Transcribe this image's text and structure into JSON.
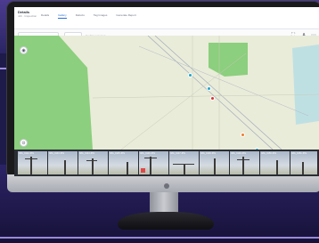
{
  "app": {
    "title": "Details",
    "subtitle": "Job · Inspection"
  },
  "tabs": [
    {
      "label": "Details",
      "active": false
    },
    {
      "label": "Gallery",
      "active": true
    },
    {
      "label": "Defects",
      "active": false
    },
    {
      "label": "Tag Images",
      "active": false
    },
    {
      "label": "Generate Report",
      "active": false
    }
  ],
  "toolbar": {
    "search_placeholder": "Search image",
    "filter_label": "Filter",
    "hint": "No filter selected"
  },
  "map": {
    "markers": [
      {
        "color": "#1ba6c9"
      },
      {
        "color": "#1ba6c9"
      },
      {
        "color": "#d93030"
      },
      {
        "color": "#f07a2a"
      },
      {
        "color": "#1ba6c9"
      }
    ]
  },
  "thumbnails": [
    {
      "label": "IMG_0142.JPG"
    },
    {
      "label": "IMG_0143.JPG"
    },
    {
      "label": "IMG_0144.JPG"
    },
    {
      "label": "IMG_0145.JPG"
    },
    {
      "label": "IMG_0146.JPG"
    },
    {
      "label": "IMG_0147.JPG"
    },
    {
      "label": "IMG_0148.JPG"
    },
    {
      "label": "IMG_0149.JPG"
    },
    {
      "label": "IMG_0150.JPG"
    },
    {
      "label": "IMG_0151.JPG"
    }
  ],
  "colors": {
    "accent": "#2a6fdb",
    "background": "#1e1b4b",
    "field_green": "#8ccf7e"
  }
}
